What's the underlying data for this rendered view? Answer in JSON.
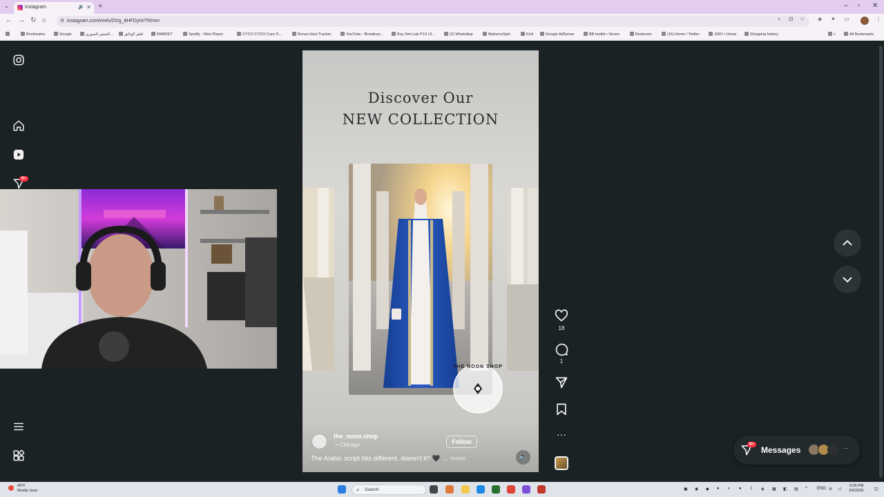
{
  "browser": {
    "tab_title": "Instagram",
    "new_tab": "+",
    "url": "instagram.com/reels/DVg_8HFDyIX/?hl=en",
    "bookmarks": [
      "Bookmarks",
      "Google",
      "الجيش السوري...",
      "قاهر الوثائق",
      "MARKET",
      "Spotify - Web Player",
      "CYCO CYCO Cure O...",
      "Bonus Hunt Tracker",
      "YouTube - Broadcas...",
      "Buy Sim-Lab P1X Ul...",
      "(2) WhatsApp",
      "MahercoSpin",
      "Kick",
      "Google AdSense",
      "BB toolkit • Seven",
      "Restream",
      "(16) Home / Twitter",
      "JOIO • Home",
      "Shopping history"
    ],
    "all_bookmarks": "All Bookmarks"
  },
  "sidebar": {
    "notification_badge": "9+"
  },
  "reel": {
    "heading_line1": "Discover Our",
    "heading_line2": "NEW COLLECTION",
    "account_name": "the_noon.shop",
    "location": "Chicago",
    "follow_label": "Follow",
    "caption": "The Arabic script hits different, doesn't it? 🖤 ...",
    "more_label": "more",
    "logo_text": "THE NOON SHOP"
  },
  "actions": {
    "likes": "18",
    "comments": "1"
  },
  "messages": {
    "label": "Messages",
    "badge": "9+"
  },
  "taskbar": {
    "weather_temp": "49°F",
    "weather_desc": "Mostly clear",
    "search_placeholder": "Search",
    "lang": "ENG",
    "time": "9:26 PM",
    "date": "3/6/2026"
  },
  "colors": {
    "page_bg": "#1b2224",
    "badge_red": "#ff3040",
    "chrome_tab_strip": "#e3cdef",
    "abaya_blue": "#1d4fb0"
  }
}
